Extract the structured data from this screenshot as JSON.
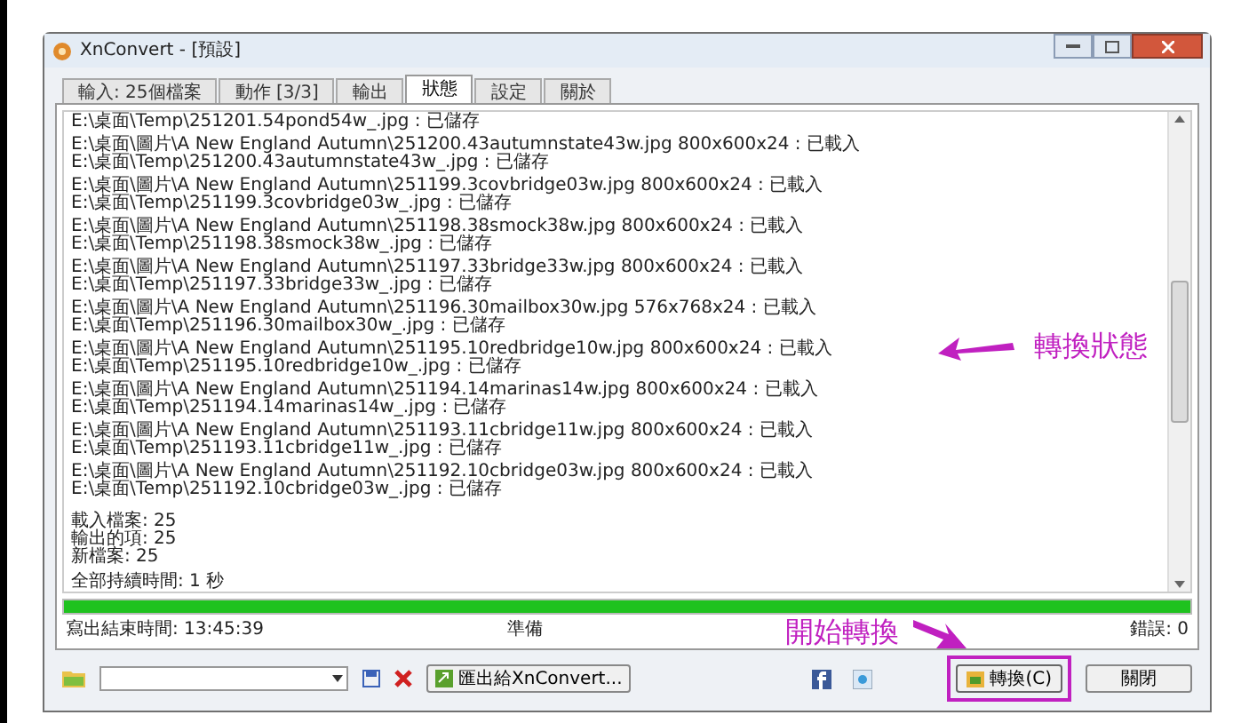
{
  "window": {
    "title": "XnConvert - [預設]"
  },
  "tabs": [
    {
      "label": "輸入: 25個檔案",
      "selected": false
    },
    {
      "label": "動作 [3/3]",
      "selected": false
    },
    {
      "label": "輸出",
      "selected": false
    },
    {
      "label": "狀態",
      "selected": true
    },
    {
      "label": "設定",
      "selected": false
    },
    {
      "label": "關於",
      "selected": false
    }
  ],
  "log": [
    {
      "lines": [
        "E:\\桌面\\Temp\\251201.54pond54w_.jpg : 已儲存"
      ]
    },
    {
      "lines": [
        "E:\\桌面\\圖片\\A New England Autumn\\251200.43autumnstate43w.jpg 800x600x24 : 已載入",
        "E:\\桌面\\Temp\\251200.43autumnstate43w_.jpg : 已儲存"
      ]
    },
    {
      "lines": [
        "E:\\桌面\\圖片\\A New England Autumn\\251199.3covbridge03w.jpg 800x600x24 : 已載入",
        "E:\\桌面\\Temp\\251199.3covbridge03w_.jpg : 已儲存"
      ]
    },
    {
      "lines": [
        "E:\\桌面\\圖片\\A New England Autumn\\251198.38smock38w.jpg 800x600x24 : 已載入",
        "E:\\桌面\\Temp\\251198.38smock38w_.jpg : 已儲存"
      ]
    },
    {
      "lines": [
        "E:\\桌面\\圖片\\A New England Autumn\\251197.33bridge33w.jpg 800x600x24 : 已載入",
        "E:\\桌面\\Temp\\251197.33bridge33w_.jpg : 已儲存"
      ]
    },
    {
      "lines": [
        "E:\\桌面\\圖片\\A New England Autumn\\251196.30mailbox30w.jpg 576x768x24 : 已載入",
        "E:\\桌面\\Temp\\251196.30mailbox30w_.jpg : 已儲存"
      ]
    },
    {
      "lines": [
        "E:\\桌面\\圖片\\A New England Autumn\\251195.10redbridge10w.jpg 800x600x24 : 已載入",
        "E:\\桌面\\Temp\\251195.10redbridge10w_.jpg : 已儲存"
      ]
    },
    {
      "lines": [
        "E:\\桌面\\圖片\\A New England Autumn\\251194.14marinas14w.jpg 800x600x24 : 已載入",
        "E:\\桌面\\Temp\\251194.14marinas14w_.jpg : 已儲存"
      ]
    },
    {
      "lines": [
        "E:\\桌面\\圖片\\A New England Autumn\\251193.11cbridge11w.jpg 800x600x24 : 已載入",
        "E:\\桌面\\Temp\\251193.11cbridge11w_.jpg : 已儲存"
      ]
    },
    {
      "lines": [
        "E:\\桌面\\圖片\\A New England Autumn\\251192.10cbridge03w.jpg 800x600x24 : 已載入",
        "E:\\桌面\\Temp\\251192.10cbridge03w_.jpg : 已儲存"
      ]
    }
  ],
  "summary": [
    "載入檔案: 25",
    "輸出的項: 25",
    "新檔案: 25"
  ],
  "total_time": "全部持續時間: 1 秒",
  "progress": {
    "level": 1
  },
  "status_bar": {
    "left": "寫出結束時間: 13:45:39",
    "center": "準備",
    "right": "錯誤: 0"
  },
  "toolbar": {
    "export_button": "匯出給XnConvert...",
    "convert_button": "轉換(C)",
    "close_button": "關閉"
  },
  "annotations": [
    {
      "kind": "left-arrow",
      "text": "轉換狀態"
    },
    {
      "kind": "down-arrow",
      "text": "開始轉換"
    }
  ]
}
